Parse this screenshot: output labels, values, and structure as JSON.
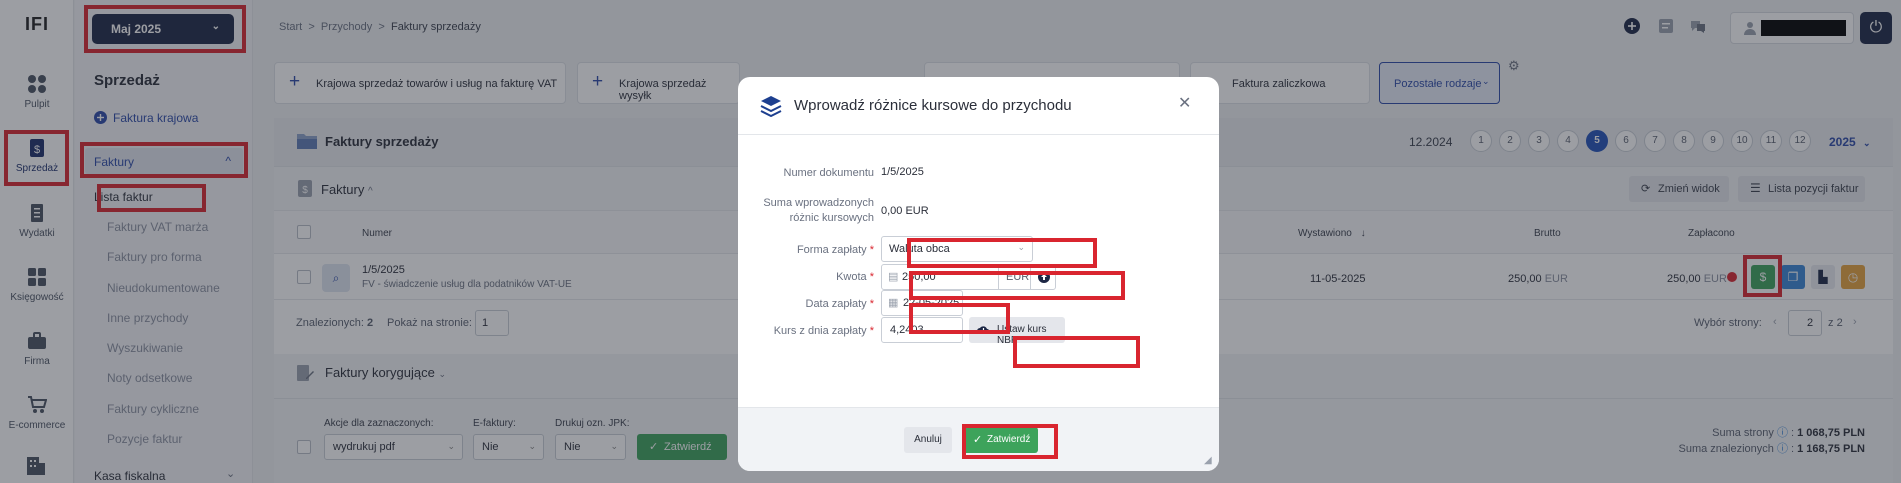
{
  "app": {
    "logo": "IFI"
  },
  "rail": [
    {
      "label": "Pulpit",
      "icon": "dashboard-icon"
    },
    {
      "label": "Sprzedaż",
      "icon": "sales-icon"
    },
    {
      "label": "Wydatki",
      "icon": "expenses-icon"
    },
    {
      "label": "Księgowość",
      "icon": "accounting-icon"
    },
    {
      "label": "Firma",
      "icon": "briefcase-icon"
    },
    {
      "label": "E-commerce",
      "icon": "cart-icon"
    }
  ],
  "menu": {
    "month": "Maj 2025",
    "section_title": "Sprzedaż",
    "primary_link": "Faktura krajowa",
    "group_label": "Faktury",
    "items": [
      "Lista faktur",
      "Faktury VAT marża",
      "Faktury pro forma",
      "Nieudokumentowane",
      "Inne przychody",
      "Wyszukiwanie",
      "Noty odsetkowe",
      "Faktury cykliczne",
      "Pozycje faktur"
    ],
    "kasa": "Kasa fiskalna"
  },
  "breadcrumb": {
    "start": "Start",
    "sep": ">",
    "przychody": "Przychody",
    "current": "Faktury sprzedaży"
  },
  "toolbar": {
    "tile1": "Krajowa sprzedaż towarów i usług na fakturę VAT",
    "tile2": "Krajowa sprzedaż wysyłk",
    "tile4": "Faktura zaliczkowa",
    "other": "Pozostałe rodzaje"
  },
  "panel": {
    "title": "Faktury sprzedaży",
    "period_label": "12.2024",
    "months": [
      "1",
      "2",
      "3",
      "4",
      "5",
      "6",
      "7",
      "8",
      "9",
      "10",
      "11",
      "12"
    ],
    "active_month": "5",
    "year": "2025",
    "sub_title": "Faktury",
    "btn_change_view": "Zmień widok",
    "btn_positions": "Lista pozycji faktur"
  },
  "table": {
    "col_numer": "Numer",
    "col_wystawiono": "Wystawiono",
    "col_brutto": "Brutto",
    "col_zaplacono": "Zapłacono",
    "row": {
      "numer": "1/5/2025",
      "opis": "FV - świadczenie usług dla podatników VAT-UE",
      "wystawiono": "11-05-2025",
      "brutto": "250,00",
      "brutto_cur": "EUR",
      "zaplacono": "250,00",
      "zaplacono_cur": "EUR"
    },
    "found_label": "Znalezionych:",
    "found_count": "2",
    "per_page_label": "Pokaż na stronie:",
    "per_page": "1",
    "page_select_label": "Wybór strony:",
    "page_current": "2",
    "page_of": "z",
    "page_total": "2"
  },
  "corrective": {
    "title": "Faktury korygujące",
    "actions_label": "Akcje dla zaznaczonych:",
    "actions_value": "wydrukuj pdf",
    "efaktury_label": "E-faktury:",
    "efaktury_value": "Nie",
    "jpk_label": "Drukuj ozn. JPK:",
    "jpk_value": "Nie",
    "confirm": "Zatwierdź",
    "sum_page_label": "Suma strony",
    "sum_page_value": "1 068,75 PLN",
    "sum_found_label": "Suma znalezionych",
    "sum_found_value": "1 168,75 PLN"
  },
  "modal": {
    "title": "Wprowadź różnice kursowe do przychodu",
    "doc_label": "Numer dokumentu",
    "doc_value": "1/5/2025",
    "sum_label_1": "Suma wprowadzonych",
    "sum_label_2": "różnic kursowych",
    "sum_value": "0,00 EUR",
    "form_label": "Forma zapłaty",
    "form_value": "Waluta obca",
    "amount_label": "Kwota",
    "amount_value": "250,00",
    "amount_currency": "EUR",
    "date_label": "Data zapłaty",
    "date_value": "22-05-2025",
    "rate_label": "Kurs z dnia zapłaty",
    "rate_value": "4,2403",
    "nbp_button": "Ustaw kurs NBP",
    "required_mark": "*",
    "cancel": "Anuluj",
    "confirm": "Zatwierdź"
  },
  "colors": {
    "accent": "#2250b8",
    "navy": "#1d2745",
    "highlight": "#d9252f",
    "success": "#3da35b",
    "warning": "#e6a23c"
  }
}
